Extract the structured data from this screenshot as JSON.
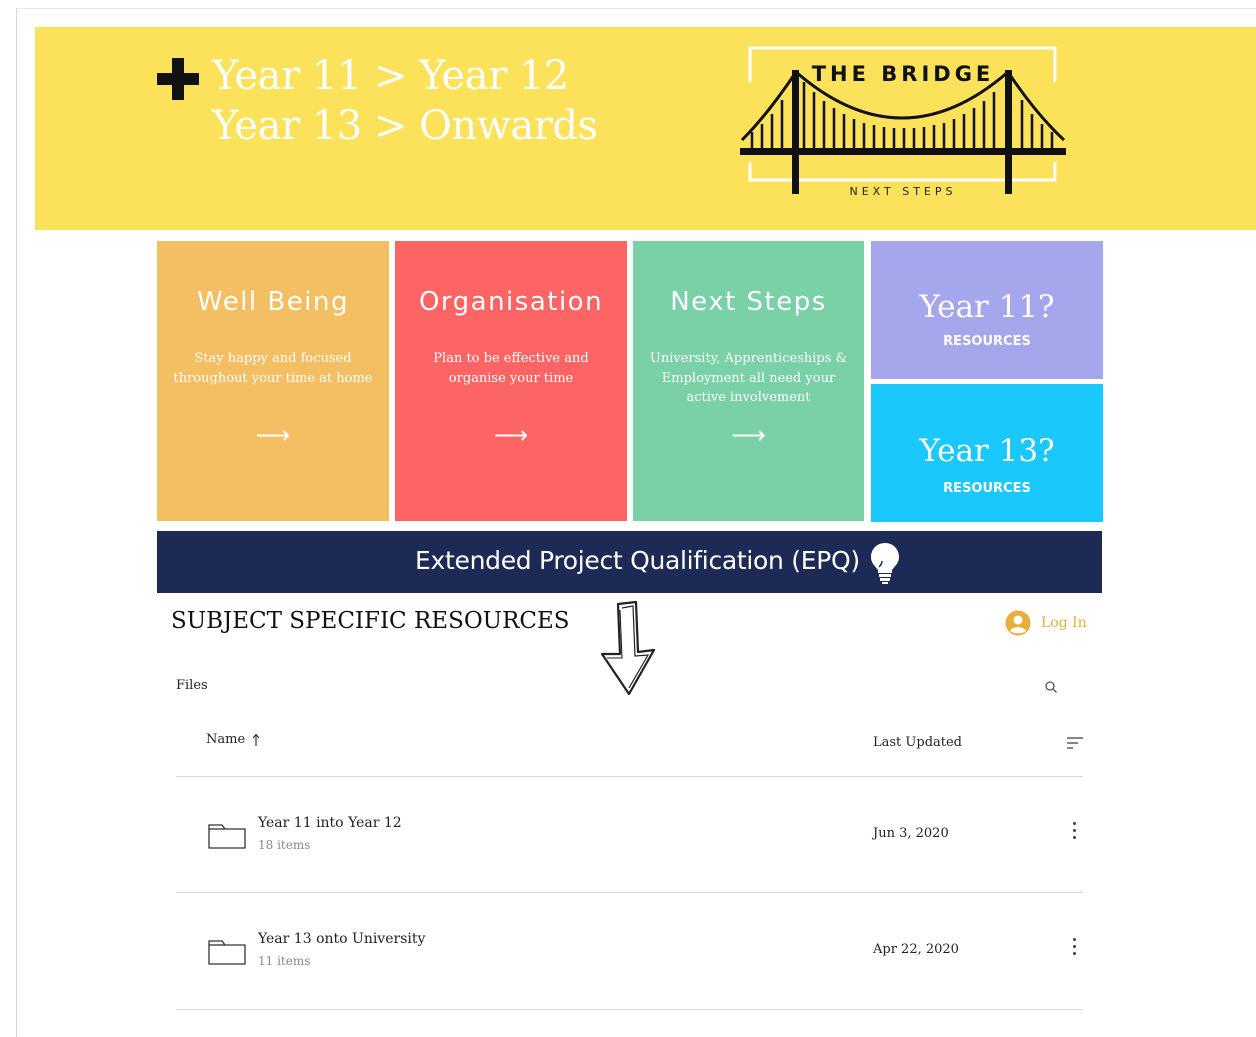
{
  "banner": {
    "line1": "Year 11 > Year 12",
    "line2": "Year 13 > Onwards",
    "logo_title": "THE BRIDGE",
    "logo_subtitle": "NEXT STEPS",
    "background": "#fce15a"
  },
  "tiles": [
    {
      "title": "Well Being",
      "description": "Stay happy and focused throughout your time at home",
      "arrow": "⟶",
      "color": "#f4be62"
    },
    {
      "title": "Organisation",
      "description": "Plan to be effective and organise your time",
      "arrow": "⟶",
      "color": "#fd6464"
    },
    {
      "title": "Next Steps",
      "description": "University, Apprenticeships & Employment all need your active involvement",
      "arrow": "⟶",
      "color": "#7ad0a7"
    }
  ],
  "year_tiles": [
    {
      "title": "Year 11?",
      "subtitle": "RESOURCES",
      "color": "#a5a6ec"
    },
    {
      "title": "Year 13?",
      "subtitle": "RESOURCES",
      "color": "#1ac8fb"
    }
  ],
  "epq": {
    "label": "Extended Project Qualification (EPQ)",
    "icon": "lightbulb-icon",
    "color": "#1e2a56"
  },
  "resources": {
    "title": "SUBJECT SPECIFIC RESOURCES",
    "login_label": "Log In",
    "files_label": "Files",
    "columns": {
      "name": "Name",
      "updated": "Last Updated"
    },
    "rows": [
      {
        "name": "Year 11 into Year 12",
        "count": "18 items",
        "date": "Jun 3, 2020"
      },
      {
        "name": "Year 13 onto University",
        "count": "11 items",
        "date": "Apr 22, 2020"
      }
    ],
    "accent": "#e7ae3a"
  }
}
